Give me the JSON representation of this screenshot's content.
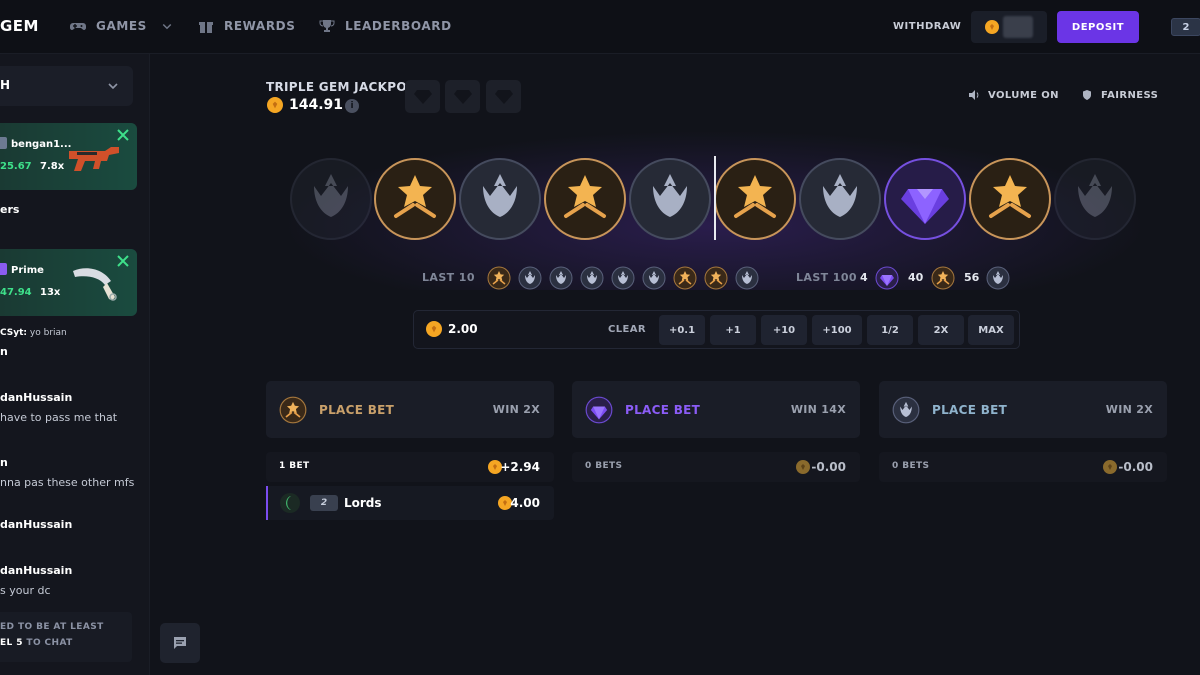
{
  "nav": {
    "logo": "GEM",
    "games": "GAMES",
    "rewards": "REWARDS",
    "leaderboard": "LEADERBOARD",
    "withdraw": "WITHDRAW",
    "deposit": "DEPOSIT",
    "level": "2"
  },
  "sidebar": {
    "language": "H",
    "wins": [
      {
        "user": "bengan1...",
        "amount": "25.67",
        "multiplier": "7.8x"
      },
      {
        "user": "Prime",
        "amount": "47.94",
        "multiplier": "13x"
      }
    ],
    "section_label": "ers",
    "chat": [
      {
        "user": "CSyt:",
        "text": "yo brian"
      },
      {
        "user": "n",
        "text": ""
      },
      {
        "user": "danHussain",
        "text": "have to pass me that"
      },
      {
        "user": "n",
        "text": ""
      },
      {
        "user": "",
        "text": "nna pas these other mfs"
      },
      {
        "user": "danHussain",
        "text": ""
      },
      {
        "user": "danHussain",
        "text": "s your dc"
      }
    ],
    "chat_lock_line1": "ED TO BE AT LEAST",
    "chat_lock_line2_bold": "EL 5",
    "chat_lock_line2_rest": " TO CHAT"
  },
  "jackpot": {
    "title": "TRIPLE GEM JACKPOT",
    "amount": "144.91",
    "info": "i"
  },
  "controls": {
    "volume": "VOLUME ON",
    "fairness": "FAIRNESS"
  },
  "roulette": {
    "sequence": [
      "ct",
      "t",
      "ct",
      "t",
      "ct",
      "t",
      "ct",
      "gem",
      "t",
      "ct"
    ]
  },
  "history": {
    "last10_label": "LAST 10",
    "last10": [
      "t",
      "ct",
      "ct",
      "ct",
      "ct",
      "ct",
      "t",
      "t",
      "ct"
    ],
    "last100_label": "LAST 100",
    "gem_count": "4",
    "t_count": "40",
    "ct_count": "56"
  },
  "bet": {
    "amount": "2.00",
    "clear": "CLEAR",
    "buttons": [
      "+0.1",
      "+1",
      "+10",
      "+100",
      "1/2",
      "2X",
      "MAX"
    ]
  },
  "columns": [
    {
      "label": "PLACE BET",
      "win": "WIN 2X",
      "bets": "1 BET",
      "total": "+2.94",
      "color": "#c9a06a"
    },
    {
      "label": "PLACE BET",
      "win": "WIN 14X",
      "bets": "0 BETS",
      "total": "-0.00",
      "color": "#8b5cf6"
    },
    {
      "label": "PLACE BET",
      "win": "WIN 2X",
      "bets": "0 BETS",
      "total": "-0.00",
      "color": "#8fb3cc"
    }
  ],
  "bettor": {
    "level": "2",
    "name": "Lords",
    "amount": "4.00"
  },
  "colors": {
    "accent": "#6b35e6",
    "coin": "#f5a623",
    "positive": "#3ee08a"
  }
}
